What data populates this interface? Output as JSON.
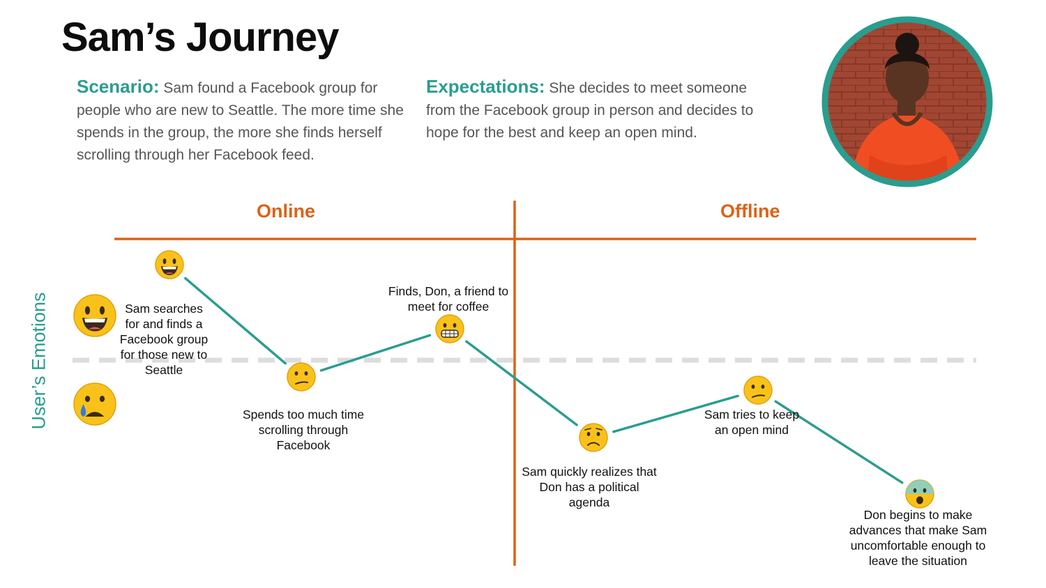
{
  "title": "Sam’s Journey",
  "scenario": {
    "label": "Scenario:",
    "text": "Sam found a Facebook group for people who are new to Seattle. The more time she spends in the group, the more she finds herself scrolling through her Facebook feed."
  },
  "expectations": {
    "label": "Expectations:",
    "text": "She decides to meet someone from the Facebook group in person and decides to hope for the best and keep an open mind."
  },
  "avatar": {
    "icon": "person-portrait",
    "ring_color": "#2a9d8f"
  },
  "journey": {
    "y_label": "User’s Emotions",
    "sections": [
      "Online",
      "Offline"
    ],
    "scale": {
      "positive_icon": "grinning-face-icon",
      "negative_icon": "crying-face-icon"
    },
    "steps": [
      {
        "stage": "Online",
        "emotion": "grinning",
        "text": "Sam searches for and finds a Facebook group for those new to Seattle"
      },
      {
        "stage": "Online",
        "emotion": "confused",
        "text": "Spends too much time scrolling through Facebook"
      },
      {
        "stage": "Online",
        "emotion": "grimacing",
        "text": "Finds, Don,  a friend to meet for coffee"
      },
      {
        "stage": "Offline",
        "emotion": "worried",
        "text": "Sam quickly realizes that Don has a political agenda"
      },
      {
        "stage": "Offline",
        "emotion": "confused",
        "text": "Sam tries to keep an open mind"
      },
      {
        "stage": "Offline",
        "emotion": "anxious",
        "text": "Don begins to make advances that make Sam uncomfortable enough to leave the situation"
      }
    ]
  },
  "colors": {
    "teal": "#2a9d8f",
    "orange": "#dd6216",
    "dashed_line": "#dddddd",
    "emoji_yellow": "#f9c21a"
  }
}
